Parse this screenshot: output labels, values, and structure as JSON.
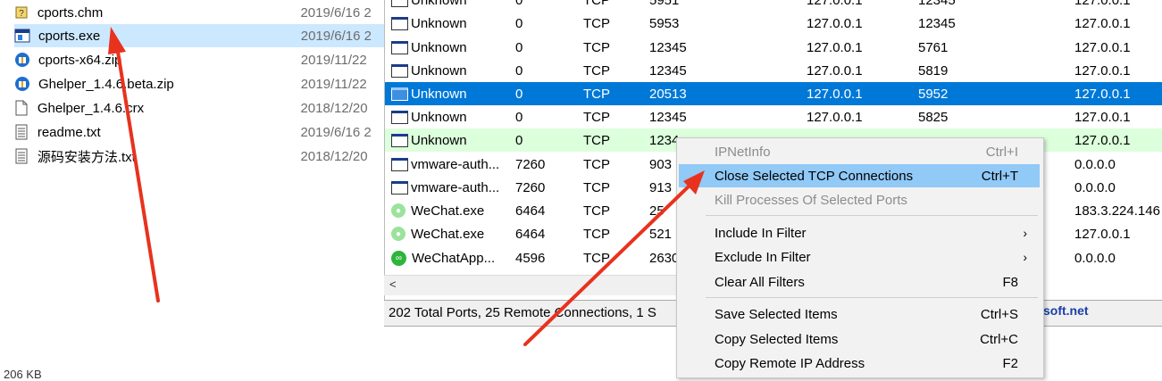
{
  "explorer": {
    "files": [
      {
        "name": "cports.chm",
        "date": "2019/6/16 2",
        "icon": "help-file-icon"
      },
      {
        "name": "cports.exe",
        "date": "2019/6/16 2",
        "icon": "exe-icon",
        "selected": true
      },
      {
        "name": "cports-x64.zip",
        "date": "2019/11/22",
        "icon": "zip-icon"
      },
      {
        "name": "Ghelper_1.4.6.beta.zip",
        "date": "2019/11/22",
        "icon": "zip-icon"
      },
      {
        "name": "Ghelper_1.4.6.crx",
        "date": "2018/12/20",
        "icon": "file-icon"
      },
      {
        "name": "readme.txt",
        "date": "2019/6/16 2",
        "icon": "text-file-icon"
      },
      {
        "name": "源码安装方法.txt",
        "date": "2018/12/20",
        "icon": "text-file-icon"
      }
    ],
    "status": "206 KB"
  },
  "currports": {
    "rows": [
      {
        "process": "Unknown",
        "pid": "0",
        "protocol": "TCP",
        "local_port": "5951",
        "local_addr": "127.0.0.1",
        "remote_port": "12345",
        "remote_addr": "127.0.0.1"
      },
      {
        "process": "Unknown",
        "pid": "0",
        "protocol": "TCP",
        "local_port": "5953",
        "local_addr": "127.0.0.1",
        "remote_port": "12345",
        "remote_addr": "127.0.0.1"
      },
      {
        "process": "Unknown",
        "pid": "0",
        "protocol": "TCP",
        "local_port": "12345",
        "local_addr": "127.0.0.1",
        "remote_port": "5761",
        "remote_addr": "127.0.0.1"
      },
      {
        "process": "Unknown",
        "pid": "0",
        "protocol": "TCP",
        "local_port": "12345",
        "local_addr": "127.0.0.1",
        "remote_port": "5819",
        "remote_addr": "127.0.0.1"
      },
      {
        "process": "Unknown",
        "pid": "0",
        "protocol": "TCP",
        "local_port": "20513",
        "local_addr": "127.0.0.1",
        "remote_port": "5952",
        "remote_addr": "127.0.0.1",
        "selected": true
      },
      {
        "process": "Unknown",
        "pid": "0",
        "protocol": "TCP",
        "local_port": "12345",
        "local_addr": "127.0.0.1",
        "remote_port": "5825",
        "remote_addr": "127.0.0.1"
      },
      {
        "process": "Unknown",
        "pid": "0",
        "protocol": "TCP",
        "local_port": "1234",
        "local_addr": "",
        "remote_port": "",
        "remote_addr": "127.0.0.1",
        "highlight": "green"
      },
      {
        "process": "vmware-auth...",
        "pid": "7260",
        "protocol": "TCP",
        "local_port": "903",
        "local_addr": "",
        "remote_port": "",
        "remote_addr": "0.0.0.0"
      },
      {
        "process": "vmware-auth...",
        "pid": "7260",
        "protocol": "TCP",
        "local_port": "913",
        "local_addr": "",
        "remote_port": "",
        "remote_addr": "0.0.0.0"
      },
      {
        "process": "WeChat.exe",
        "pid": "6464",
        "protocol": "TCP",
        "local_port": "25",
        "local_addr": "",
        "remote_port": "",
        "remote_addr": "183.3.224.146",
        "icon": "wechat-icon"
      },
      {
        "process": "WeChat.exe",
        "pid": "6464",
        "protocol": "TCP",
        "local_port": "521",
        "local_addr": "",
        "remote_port": "",
        "remote_addr": "127.0.0.1",
        "icon": "wechat-icon"
      },
      {
        "process": "WeChatApp...",
        "pid": "4596",
        "protocol": "TCP",
        "local_port": "2630",
        "local_addr": "",
        "remote_port": "",
        "remote_addr": "0.0.0.0",
        "icon": "wechat-app-icon"
      }
    ],
    "status_text": "202 Total Ports, 25 Remote Connections, 1 S",
    "status_link": "soft.net"
  },
  "context_menu": {
    "items": [
      {
        "label": "IPNetInfo",
        "shortcut": "Ctrl+I",
        "disabled": true
      },
      {
        "label": "Close Selected TCP Connections",
        "shortcut": "Ctrl+T",
        "highlighted": true
      },
      {
        "label": "Kill Processes Of Selected Ports",
        "shortcut": "",
        "disabled": true
      },
      {
        "label": "Include In Filter",
        "shortcut": "",
        "submenu": true
      },
      {
        "label": "Exclude In Filter",
        "shortcut": "",
        "submenu": true
      },
      {
        "label": "Clear All Filters",
        "shortcut": "F8"
      },
      {
        "label": "Save Selected Items",
        "shortcut": "Ctrl+S"
      },
      {
        "label": "Copy Selected Items",
        "shortcut": "Ctrl+C"
      },
      {
        "label": "Copy Remote IP Address",
        "shortcut": "F2"
      }
    ],
    "submenu_glyph": "›"
  },
  "colors": {
    "selection_blue": "#0078d7",
    "menu_highlight": "#91c9f7",
    "annotation_arrow": "#e8321e",
    "green_row": "#dcffdc"
  }
}
